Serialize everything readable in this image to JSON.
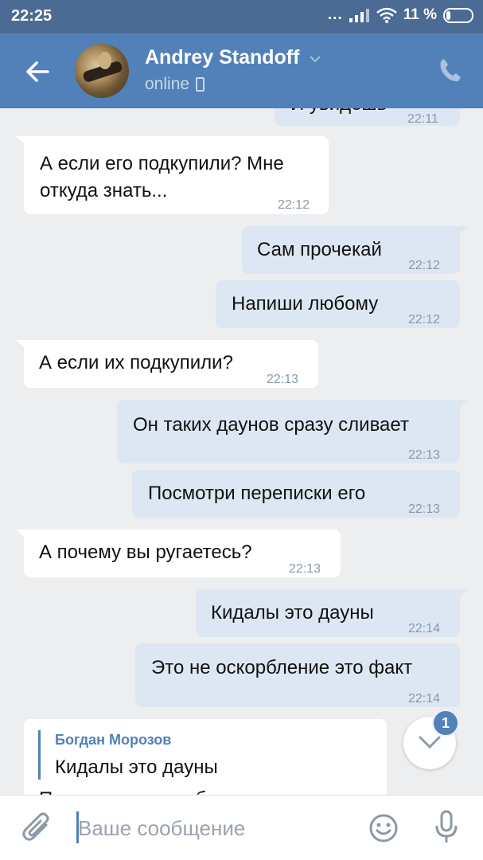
{
  "status_bar": {
    "time": "22:25",
    "signal": "...",
    "battery": "11 %"
  },
  "header": {
    "name": "Andrey Standoff",
    "status": "online"
  },
  "messages": [
    {
      "dir": "out",
      "text": "И увидешь",
      "time": "22:11"
    },
    {
      "dir": "in",
      "lines": [
        "А если его подкупили? Мне",
        "откуда знать..."
      ],
      "time": "22:12"
    },
    {
      "dir": "out",
      "text": "Сам прочекай",
      "time": "22:12"
    },
    {
      "dir": "out",
      "text": "Напиши любому",
      "time": "22:12"
    },
    {
      "dir": "in",
      "text": "А если их подкупили?",
      "time": "22:13"
    },
    {
      "dir": "out",
      "text": "Он таких даунов сразу сливает",
      "time": "22:13"
    },
    {
      "dir": "out",
      "text": "Посмотри переписки его",
      "time": "22:13"
    },
    {
      "dir": "in",
      "text": "А почему вы ругаетесь?",
      "time": "22:13"
    },
    {
      "dir": "out",
      "text": "Кидалы это дауны",
      "time": "22:14"
    },
    {
      "dir": "out",
      "text": "Это не оскорбление это факт",
      "time": "22:14"
    },
    {
      "dir": "in",
      "reply_author": "Богдан Морозов",
      "reply_text": "Кидалы это дауны",
      "partial": "Почему это оскорбление"
    }
  ],
  "unread_count": "1",
  "composer": {
    "placeholder": "Ваше сообщение"
  },
  "colors": {
    "header": "#5181b8",
    "status_bar": "#4b6b94",
    "outgoing": "#dde7f3",
    "incoming": "#ffffff",
    "background": "#edeef0"
  }
}
